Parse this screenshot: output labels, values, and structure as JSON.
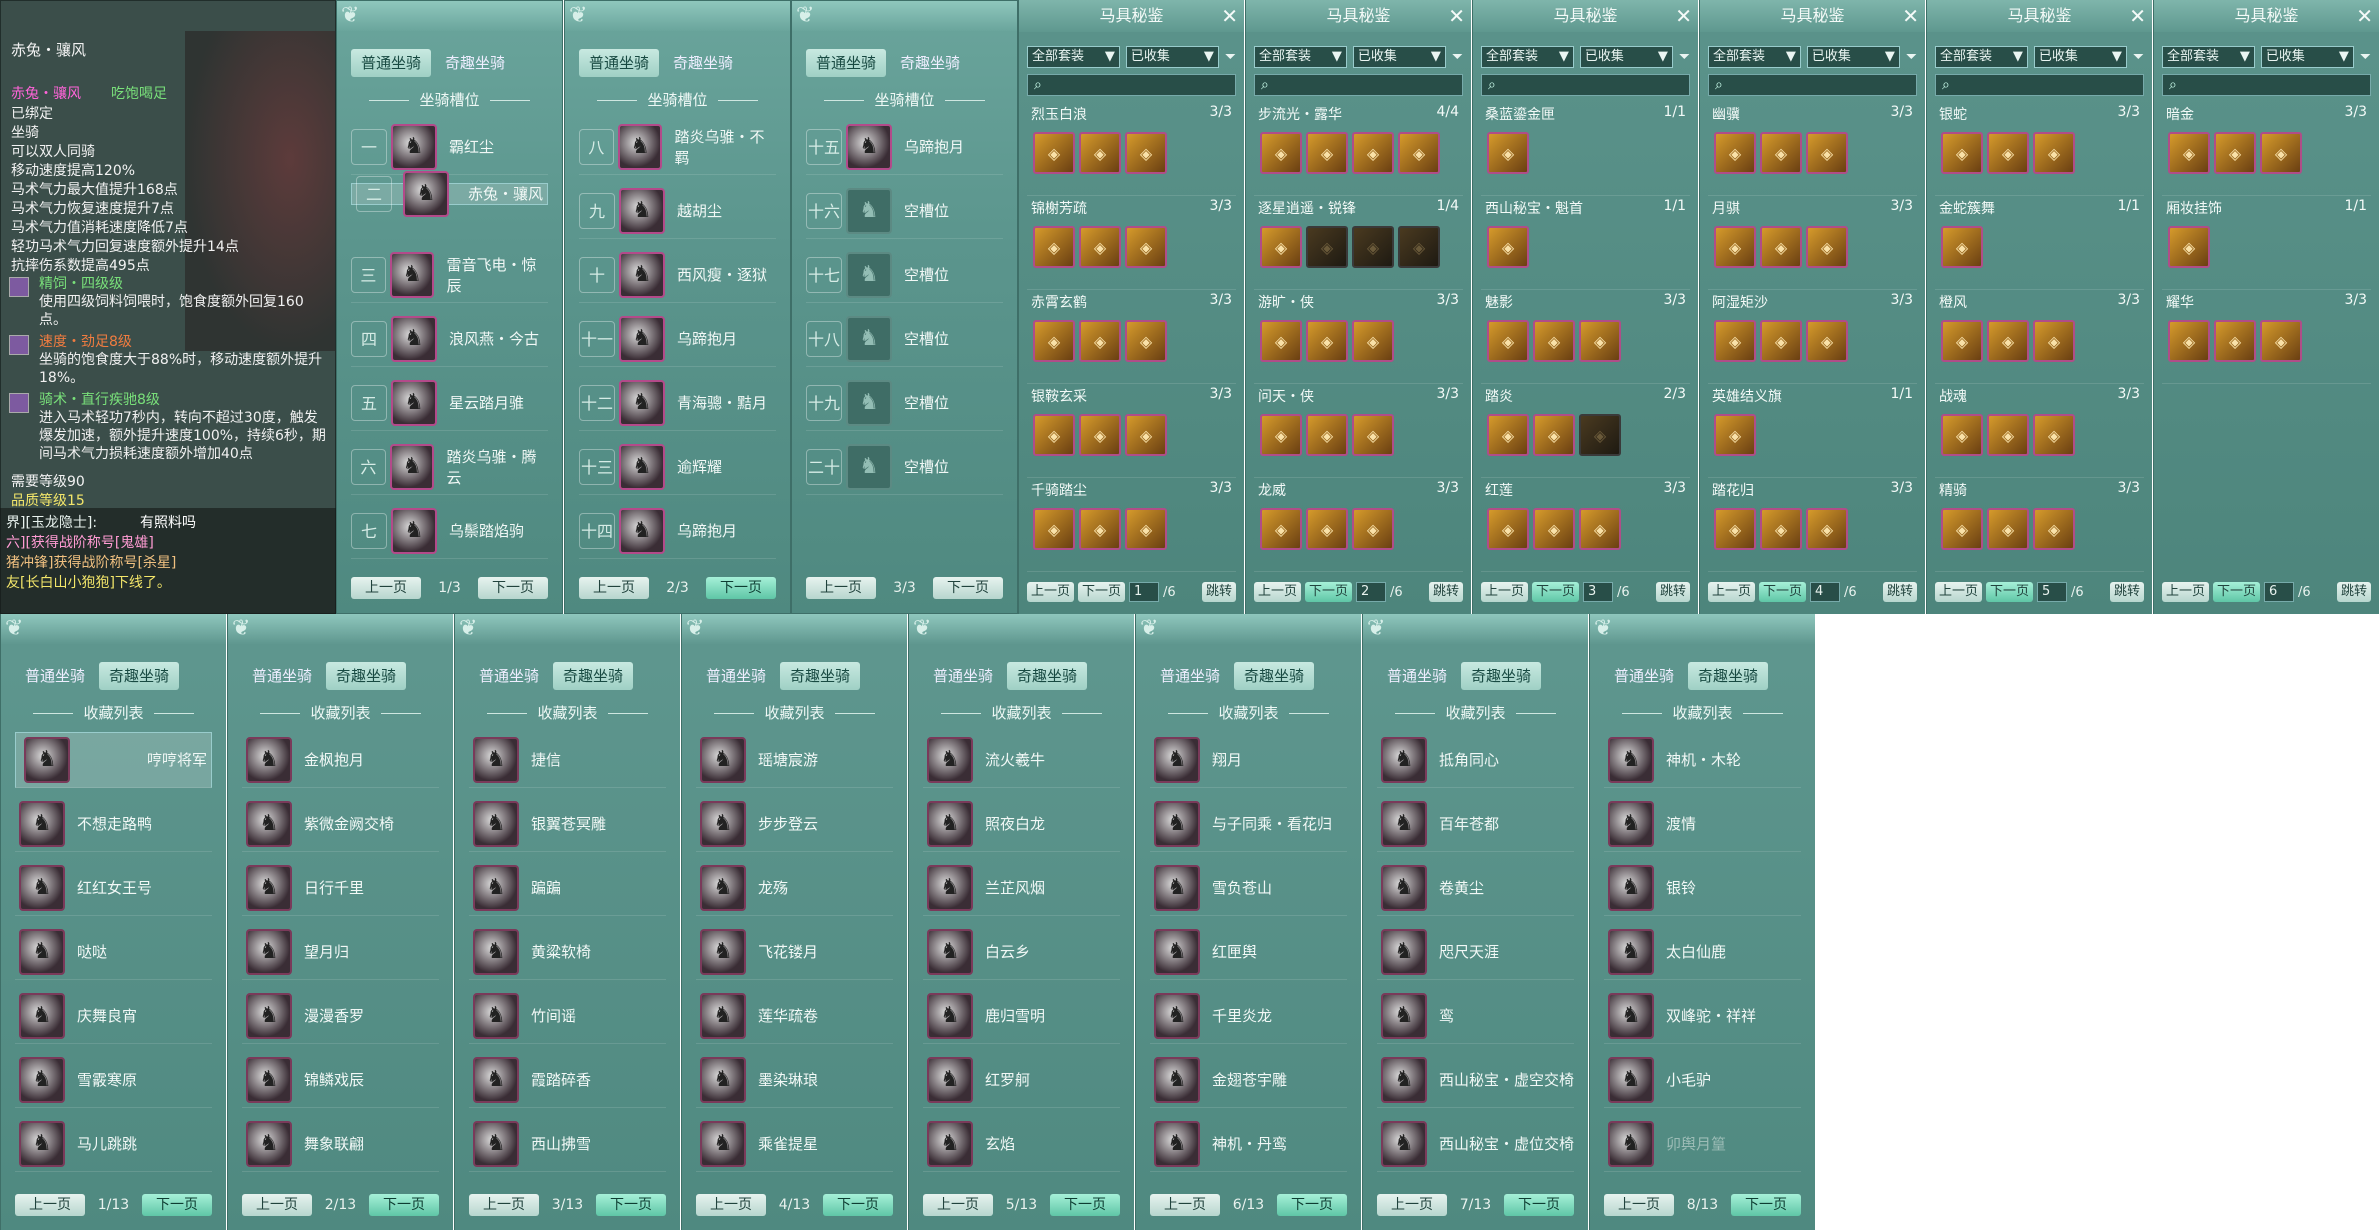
{
  "tooltip": {
    "title": "赤兔・骧风",
    "name": "赤兔・骧风",
    "status": "吃饱喝足",
    "bound": "已绑定",
    "type": "坐骑",
    "double": "可以双人同骑",
    "attrs": [
      "移动速度提高120%",
      "马术气力最大值提升168点",
      "马术气力恢复速度提升7点",
      "马术气力值消耗速度降低7点",
      "轻功马术气力回复速度额外提升14点",
      "抗摔伤系数提高495点"
    ],
    "skills": [
      {
        "name": "精饲・四级级",
        "desc": "使用四级饲料饲喂时，饱食度额外回复160点。"
      },
      {
        "name": "速度・劲足8级",
        "desc": "坐骑的饱食度大于88%时，移动速度额外提升18%。"
      },
      {
        "name": "骑术・直行疾驰8级",
        "desc": "进入马术轻功7秒内，转向不超过30度，触发爆发加速，额外提升速度100%，持续6秒，期间马术气力损耗速度额外增加40点"
      }
    ],
    "req_level": "需要等级90",
    "quality": "品质等级15"
  },
  "chat": [
    "界][玉龙隐士]:",
    "有照料吗",
    "六][获得战阶称号[鬼雄]",
    "猪冲锋]获得战阶称号[杀星]",
    "友[长白山小狍狍]下线了。"
  ],
  "tabs": {
    "normal": "普通坐骑",
    "fun": "奇趣坐骑"
  },
  "slot_header": "坐骑槽位",
  "fav_header": "收藏列表",
  "prev": "上一页",
  "next": "下一页",
  "slot_pages": [
    {
      "page": "1/3",
      "rows": [
        {
          "n": "一",
          "name": "霸红尘"
        },
        {
          "n": "二",
          "name": "赤兔・骧风",
          "sel": true
        },
        {
          "n": "三",
          "name": "雷音飞电・惊辰"
        },
        {
          "n": "四",
          "name": "浪风燕・今古"
        },
        {
          "n": "五",
          "name": "星云踏月骓"
        },
        {
          "n": "六",
          "name": "踏炎乌骓・腾云"
        },
        {
          "n": "七",
          "name": "乌鬃踏焰驹"
        }
      ]
    },
    {
      "page": "2/3",
      "rows": [
        {
          "n": "八",
          "name": "踏炎乌骓・不羁"
        },
        {
          "n": "九",
          "name": "越胡尘"
        },
        {
          "n": "十",
          "name": "西风瘦・逐狱"
        },
        {
          "n": "十一",
          "name": "乌蹄抱月"
        },
        {
          "n": "十二",
          "name": "青海骢・黠月"
        },
        {
          "n": "十三",
          "name": "逾辉耀"
        },
        {
          "n": "十四",
          "name": "乌蹄抱月"
        }
      ]
    },
    {
      "page": "3/3",
      "rows": [
        {
          "n": "十五",
          "name": "乌蹄抱月"
        },
        {
          "n": "十六",
          "name": "空槽位",
          "empty": true
        },
        {
          "n": "十七",
          "name": "空槽位",
          "empty": true
        },
        {
          "n": "十八",
          "name": "空槽位",
          "empty": true
        },
        {
          "n": "十九",
          "name": "空槽位",
          "empty": true
        },
        {
          "n": "二十",
          "name": "空槽位",
          "empty": true
        }
      ]
    }
  ],
  "codex": {
    "title": "马具秘鉴",
    "filter1": "全部套装",
    "filter2": "已收集",
    "jump": "跳转",
    "total": "/6",
    "pages": [
      {
        "page": "1",
        "sets": [
          {
            "name": "烈玉白浪",
            "count": "3/3",
            "n": 3
          },
          {
            "name": "锦榭芳疏",
            "count": "3/3",
            "n": 3
          },
          {
            "name": "赤霄玄鹤",
            "count": "3/3",
            "n": 3
          },
          {
            "name": "银鞍玄采",
            "count": "3/3",
            "n": 3
          },
          {
            "name": "千骑踏尘",
            "count": "3/3",
            "n": 3
          }
        ]
      },
      {
        "page": "2",
        "sets": [
          {
            "name": "步流光・露华",
            "count": "4/4",
            "n": 4
          },
          {
            "name": "逐星逍遥・锐锋",
            "count": "1/4",
            "n": 4,
            "dim": 3
          },
          {
            "name": "游旷・侠",
            "count": "3/3",
            "n": 3
          },
          {
            "name": "问天・侠",
            "count": "3/3",
            "n": 3
          },
          {
            "name": "龙威",
            "count": "3/3",
            "n": 3
          }
        ]
      },
      {
        "page": "3",
        "sets": [
          {
            "name": "桑蓝鎏金匣",
            "count": "1/1",
            "n": 1
          },
          {
            "name": "西山秘宝・魁首",
            "count": "1/1",
            "n": 1
          },
          {
            "name": "魅影",
            "count": "3/3",
            "n": 3
          },
          {
            "name": "踏炎",
            "count": "2/3",
            "n": 3,
            "dim": 1
          },
          {
            "name": "红莲",
            "count": "3/3",
            "n": 3
          }
        ]
      },
      {
        "page": "4",
        "sets": [
          {
            "name": "幽骥",
            "count": "3/3",
            "n": 3
          },
          {
            "name": "月骐",
            "count": "3/3",
            "n": 3
          },
          {
            "name": "阿湿矩沙",
            "count": "3/3",
            "n": 3
          },
          {
            "name": "英雄结义旗",
            "count": "1/1",
            "n": 1
          },
          {
            "name": "踏花归",
            "count": "3/3",
            "n": 3
          }
        ]
      },
      {
        "page": "5",
        "sets": [
          {
            "name": "银蛇",
            "count": "3/3",
            "n": 3
          },
          {
            "name": "金蛇簇舞",
            "count": "1/1",
            "n": 1
          },
          {
            "name": "橙风",
            "count": "3/3",
            "n": 3
          },
          {
            "name": "战魂",
            "count": "3/3",
            "n": 3
          },
          {
            "name": "精骑",
            "count": "3/3",
            "n": 3
          }
        ]
      },
      {
        "page": "6",
        "sets": [
          {
            "name": "暗金",
            "count": "3/3",
            "n": 3
          },
          {
            "name": "厢妆挂饰",
            "count": "1/1",
            "n": 1
          },
          {
            "name": "耀华",
            "count": "3/3",
            "n": 3
          }
        ]
      }
    ]
  },
  "fav_pages": [
    {
      "page": "1/13",
      "items": [
        "哼哼将军",
        "不想走路鸭",
        "红红女王号",
        "哒哒",
        "庆舞良宵",
        "雪霰寒原",
        "马儿跳跳"
      ]
    },
    {
      "page": "2/13",
      "items": [
        "金枫抱月",
        "紫微金阙交椅",
        "日行千里",
        "望月归",
        "漫漫香罗",
        "锦鳞戏辰",
        "舞象联翩"
      ]
    },
    {
      "page": "3/13",
      "items": [
        "捷信",
        "银翼苍冥雕",
        "蹁蹁",
        "黄粱软椅",
        "竹间谣",
        "霞踏碎香",
        "西山拂雪"
      ]
    },
    {
      "page": "4/13",
      "items": [
        "瑶塘宸游",
        "步步登云",
        "龙殇",
        "飞花镂月",
        "莲华疏卷",
        "墨染琳琅",
        "乘雀提星"
      ]
    },
    {
      "page": "5/13",
      "items": [
        "流火羲牛",
        "照夜白龙",
        "兰芷风烟",
        "白云乡",
        "鹿归雪明",
        "红罗舸",
        "玄焰"
      ]
    },
    {
      "page": "6/13",
      "items": [
        "翔月",
        "与子同乘・看花归",
        "雪负苍山",
        "红匣舆",
        "千里炎龙",
        "金翅苍宇雕",
        "神机・丹鸾"
      ]
    },
    {
      "page": "7/13",
      "items": [
        "抵角同心",
        "百年苍都",
        "卷黄尘",
        "咫尺天涯",
        "鸾",
        "西山秘宝・虚空交椅",
        "西山秘宝・虚位交椅"
      ]
    },
    {
      "page": "8/13",
      "items": [
        "神机・木轮",
        "渡情",
        "银铃",
        "太白仙鹿",
        "双峰驼・祥祥",
        "小毛驴",
        "卯舆月篁"
      ]
    }
  ]
}
